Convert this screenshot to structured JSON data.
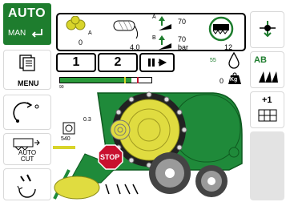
{
  "left_panel": {
    "auto_label": "AUTO",
    "man_label": "MAN",
    "menu_label": "MENU",
    "auto_cut_label": "AUTO\nCUT"
  },
  "top_panel": {
    "bale_count": "0",
    "bale_count_suffix": "A",
    "net_value": "4.0",
    "pressure_a_label": "A",
    "pressure_a_value": "70",
    "pressure_b_label": "B",
    "pressure_b_value": "70",
    "pressure_unit": "bar",
    "knife_count": "12"
  },
  "buttons": {
    "btn1": "1",
    "btn2": "2"
  },
  "status": {
    "moisture_value": "55",
    "weight_value": "0",
    "weight_unit": "Kg",
    "bar_label": "90"
  },
  "machine": {
    "value_left": "0.3",
    "value_540": "540",
    "stop_label": "STOP"
  },
  "right_panel": {
    "ab_label": "AB",
    "plus_one_label": "+1"
  },
  "colors": {
    "brand_green": "#1e7d2e",
    "machine_green": "#1f8a3a",
    "yellow": "#d8d42a",
    "stop_red": "#c8102e"
  }
}
